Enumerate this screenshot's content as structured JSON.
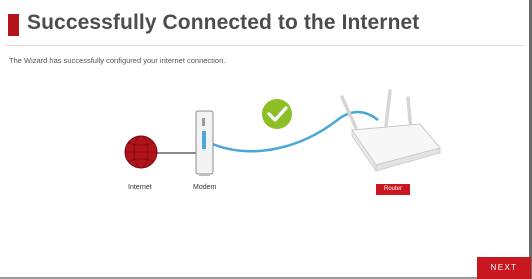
{
  "page": {
    "title": "Successfully Connected to the Internet",
    "description": "The Wizard has successfully configured your internet connection."
  },
  "diagram": {
    "internet_label": "Internet",
    "modem_label": "Modem",
    "router_label": "Router",
    "status_icon": "check-icon"
  },
  "actions": {
    "next_label": "NEXT"
  },
  "colors": {
    "accent": "#b3131b",
    "success": "#8cbf26",
    "cable": "#4aa8d8"
  }
}
